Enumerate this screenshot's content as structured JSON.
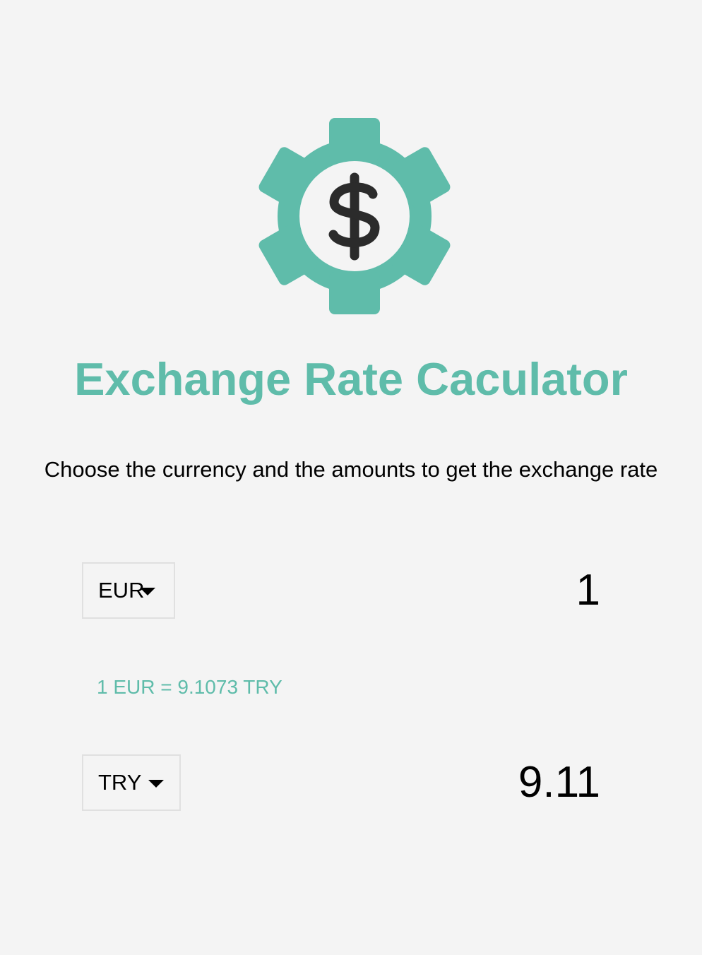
{
  "logo": {
    "icon": "dollar-gear-icon"
  },
  "title": "Exchange Rate Caculator",
  "subtitle": "Choose the currency and the amounts to get the exchange rate",
  "currency_one": {
    "selected": "EUR",
    "amount": "1"
  },
  "currency_two": {
    "selected": "TRY",
    "amount": "9.11"
  },
  "rate_text": "1 EUR = 9.1073 TRY",
  "colors": {
    "accent": "#5fbcaa",
    "background": "#f4f4f4",
    "icon_dark": "#2b2b2b",
    "text": "#000000",
    "select_border": "#e0e0e0"
  }
}
